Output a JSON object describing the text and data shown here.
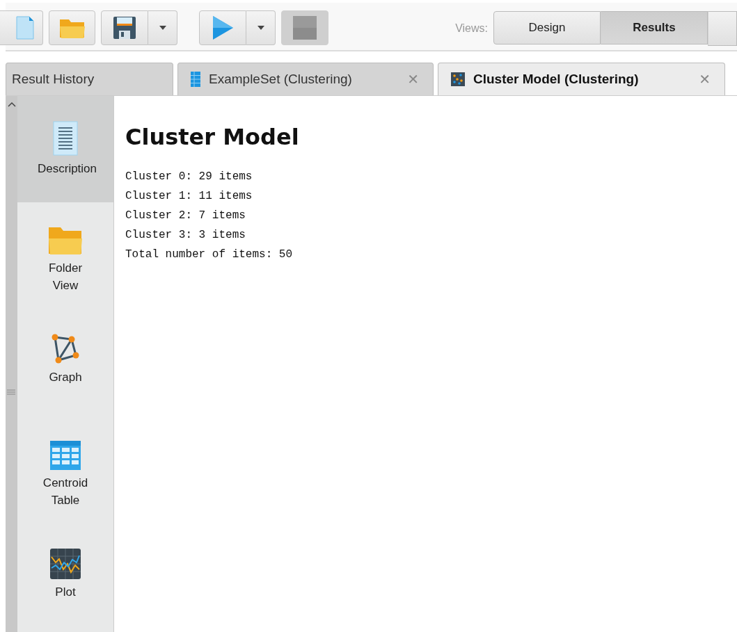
{
  "toolbar": {
    "views_label": "Views:",
    "views": [
      {
        "label": "Design",
        "selected": false
      },
      {
        "label": "Results",
        "selected": true
      }
    ]
  },
  "tabs": [
    {
      "label": "Result History",
      "selected": false,
      "closable": false
    },
    {
      "label": "ExampleSet (Clustering)",
      "selected": false,
      "closable": true
    },
    {
      "label": "Cluster Model (Clustering)",
      "selected": true,
      "closable": true
    }
  ],
  "close_glyph": "✕",
  "sidebar": {
    "items": [
      {
        "label": "Description",
        "selected": true
      },
      {
        "label": "Folder View",
        "selected": false
      },
      {
        "label": "Graph",
        "selected": false
      },
      {
        "label": "Centroid Table",
        "selected": false
      },
      {
        "label": "Plot",
        "selected": false
      }
    ]
  },
  "content": {
    "title": "Cluster Model",
    "lines": [
      "Cluster 0: 29 items",
      "Cluster 1: 11 items",
      "Cluster 2: 7 items",
      "Cluster 3: 3 items",
      "Total number of items: 50"
    ]
  }
}
